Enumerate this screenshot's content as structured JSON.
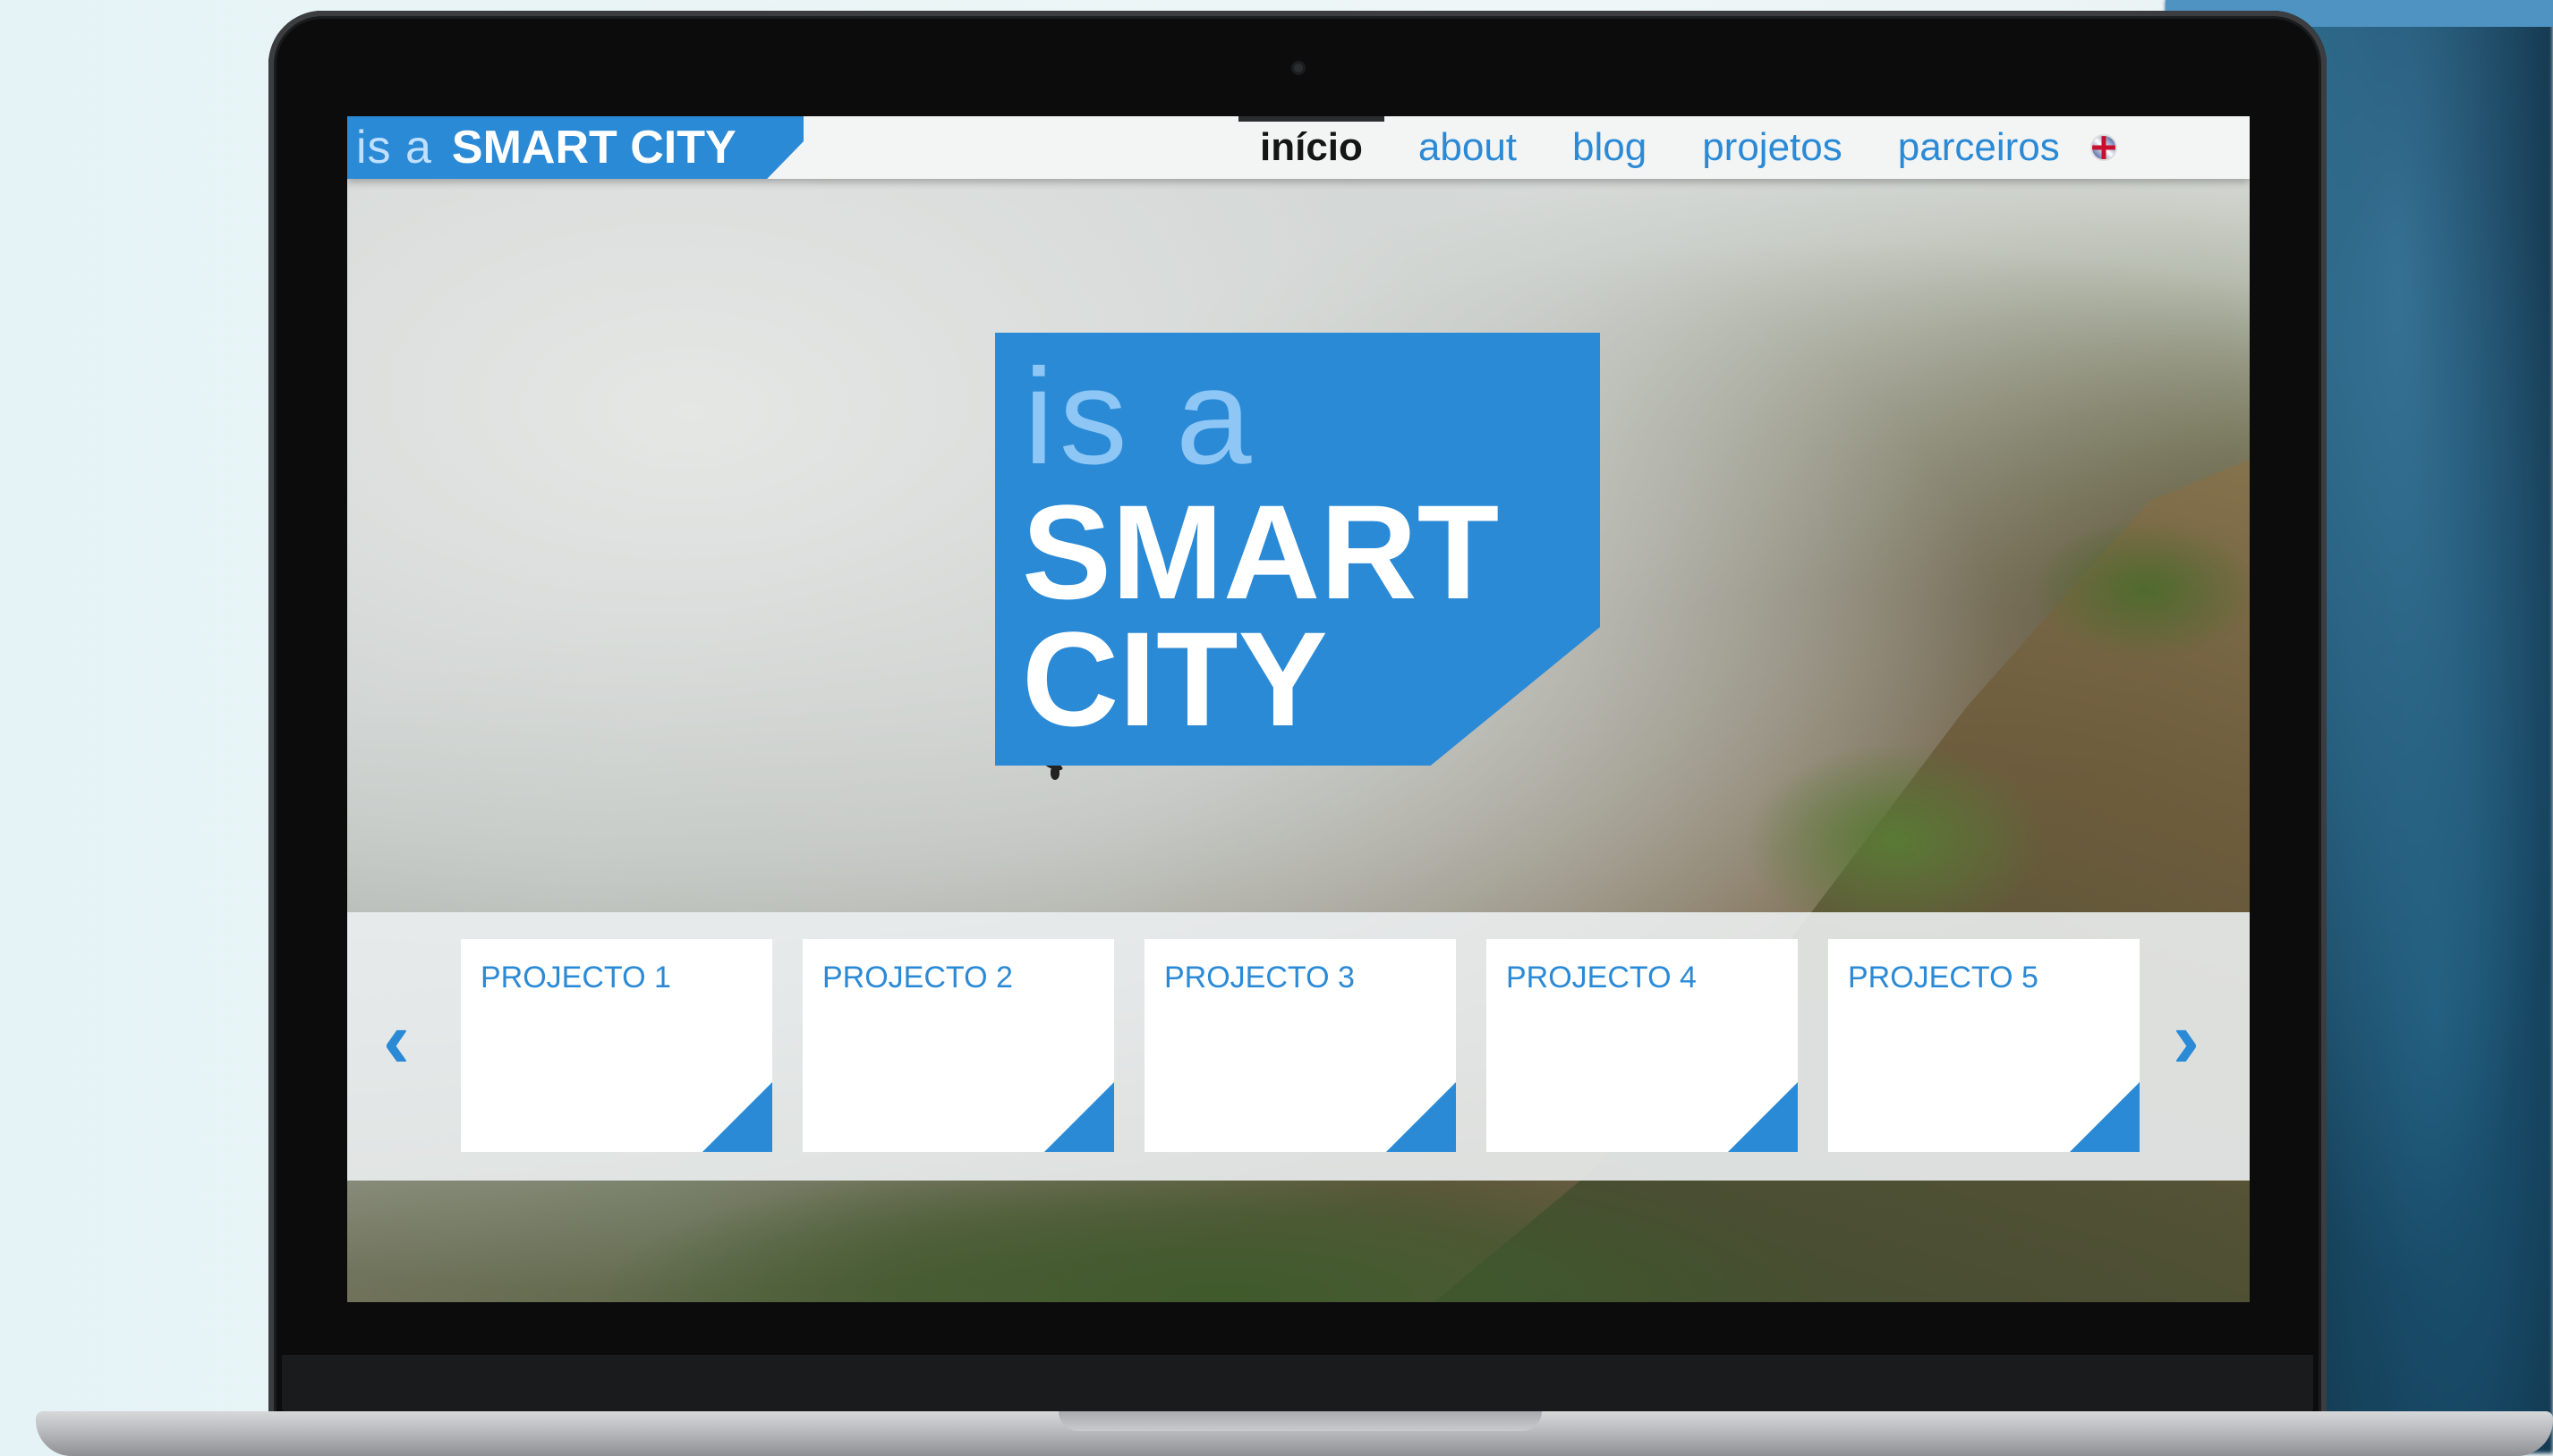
{
  "nav": {
    "brand_light": "is a",
    "brand_bold": "SMART CITY",
    "items": [
      "início",
      "about",
      "blog",
      "projetos",
      "parceiros"
    ],
    "active_index": 0,
    "language_icon": "uk-flag-icon"
  },
  "hero": {
    "logo_line1": "is a",
    "logo_line2": "SMART",
    "logo_line3": "CITY"
  },
  "carousel": {
    "prev_icon": "chevron-left-icon",
    "next_icon": "chevron-right-icon",
    "cards": [
      "PROJECTO 1",
      "PROJECTO 2",
      "PROJECTO 3",
      "PROJECTO 4",
      "PROJECTO 5"
    ]
  },
  "colors": {
    "accent": "#2b8ad6",
    "nav_bg": "#f3f4f4",
    "active_text": "#151515"
  }
}
